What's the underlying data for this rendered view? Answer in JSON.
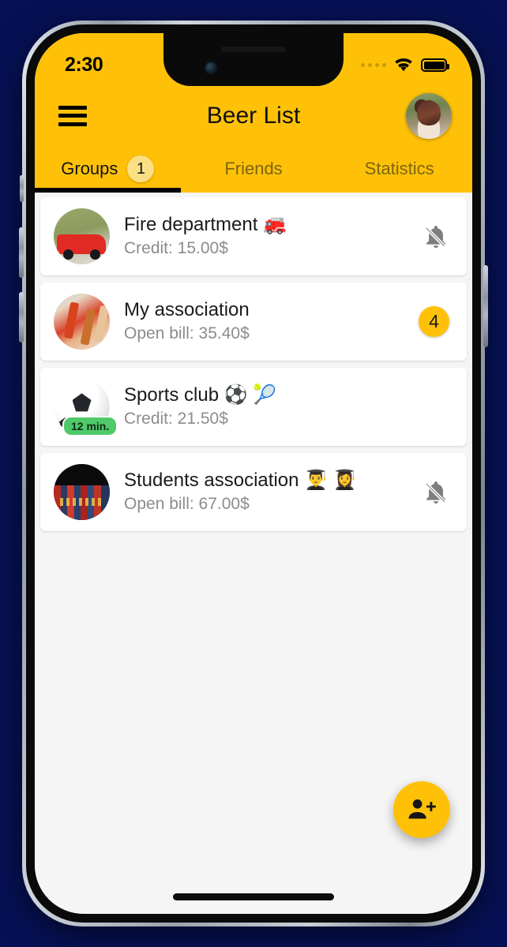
{
  "status_bar": {
    "time": "2:30",
    "signal_icon": "signal-dots-icon",
    "wifi_icon": "wifi-icon",
    "battery_icon": "battery-full-icon"
  },
  "app_bar": {
    "menu_icon": "hamburger-menu-icon",
    "title": "Beer List",
    "avatar": "user-avatar"
  },
  "tabs": [
    {
      "label": "Groups",
      "badge": "1",
      "active": true
    },
    {
      "label": "Friends",
      "badge": "",
      "active": false
    },
    {
      "label": "Statistics",
      "badge": "",
      "active": false
    }
  ],
  "groups": [
    {
      "name": "Fire department 🚒",
      "detail": "Credit: 15.00$",
      "trailing_type": "bell-off",
      "trailing_value": "",
      "time_chip": ""
    },
    {
      "name": "My association",
      "detail": "Open bill: 35.40$",
      "trailing_type": "badge",
      "trailing_value": "4",
      "time_chip": ""
    },
    {
      "name": "Sports club ⚽ 🎾",
      "detail": "Credit: 21.50$",
      "trailing_type": "none",
      "trailing_value": "",
      "time_chip": "12 min."
    },
    {
      "name": "Students association 👨‍🎓 👩‍🎓",
      "detail": "Open bill: 67.00$",
      "trailing_type": "bell-off",
      "trailing_value": "",
      "time_chip": ""
    }
  ],
  "fab": {
    "icon": "person-add-icon",
    "label": ""
  },
  "colors": {
    "accent": "#ffc107",
    "page_background": "#061155",
    "list_background": "#f5f5f5",
    "card": "#ffffff",
    "muted_text": "#8c8c8c",
    "chip_green": "#4fc96a",
    "inactive_tab_text": "#7d6410"
  }
}
